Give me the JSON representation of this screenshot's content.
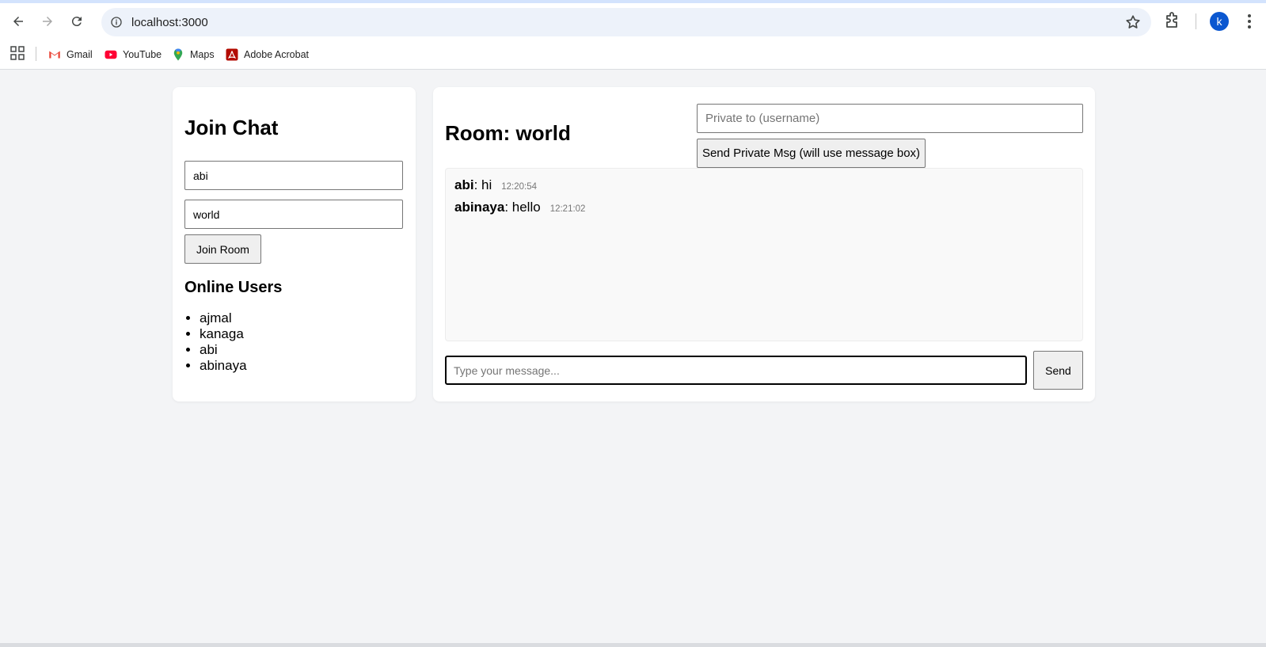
{
  "browser": {
    "url": "localhost:3000",
    "profile_initial": "k",
    "bookmarks": [
      {
        "label": "Gmail",
        "icon": "gmail-icon"
      },
      {
        "label": "YouTube",
        "icon": "youtube-icon"
      },
      {
        "label": "Maps",
        "icon": "maps-icon"
      },
      {
        "label": "Adobe Acrobat",
        "icon": "acrobat-icon"
      }
    ]
  },
  "join": {
    "title": "Join Chat",
    "username_value": "abi",
    "room_value": "world",
    "join_button": "Join Room",
    "online_title": "Online Users",
    "online_users": [
      "ajmal",
      "kanaga",
      "abi",
      "abinaya"
    ]
  },
  "chat": {
    "room_title": "Room: world",
    "private_placeholder": "Private to (username)",
    "private_button": "Send Private Msg (will use message box)",
    "messages": [
      {
        "user": "abi",
        "text": ": hi",
        "time": "12:20:54"
      },
      {
        "user": "abinaya",
        "text": ": hello",
        "time": "12:21:02"
      }
    ],
    "message_placeholder": "Type your message...",
    "send_button": "Send"
  },
  "colors": {
    "page_bg": "#f3f4f6",
    "card_bg": "#ffffff",
    "avatar": "#0b57d0"
  }
}
